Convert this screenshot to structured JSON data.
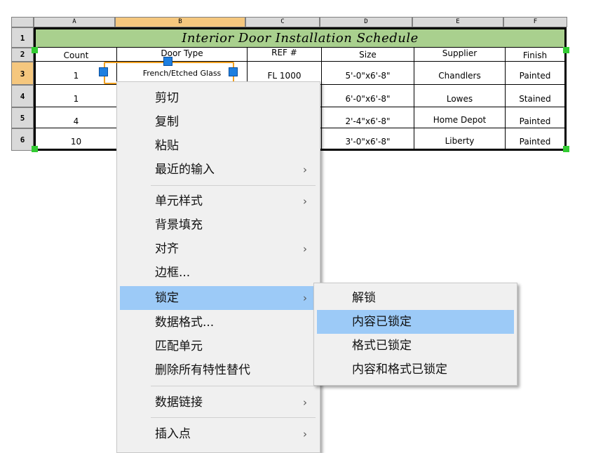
{
  "sheet": {
    "col_headers": [
      "A",
      "B",
      "C",
      "D",
      "E",
      "F"
    ],
    "row_headers": [
      "1",
      "2",
      "3",
      "4",
      "5",
      "6"
    ],
    "title": "Interior Door Installation Schedule",
    "columns": [
      "Count",
      "Door Type",
      "REF #",
      "Size",
      "Supplier",
      "Finish"
    ],
    "rows": [
      [
        "1",
        "French/Etched Glass",
        "FL 1000",
        "5'-0\"x6'-8\"",
        "Chandlers",
        "Painted"
      ],
      [
        "1",
        "",
        "",
        "6'-0\"x6'-8\"",
        "Lowes",
        "Stained"
      ],
      [
        "4",
        "",
        "",
        "2'-4\"x6'-8\"",
        "Home Depot",
        "Painted"
      ],
      [
        "10",
        "",
        "",
        "3'-0\"x6'-8\"",
        "Liberty",
        "Painted"
      ]
    ]
  },
  "context_menu": {
    "items": [
      {
        "label": "剪切",
        "submenu": false
      },
      {
        "label": "复制",
        "submenu": false
      },
      {
        "label": "粘贴",
        "submenu": false
      },
      {
        "label": "最近的输入",
        "submenu": true
      },
      {
        "label": "单元样式",
        "submenu": true
      },
      {
        "label": "背景填充",
        "submenu": false
      },
      {
        "label": "对齐",
        "submenu": true
      },
      {
        "label": "边框...",
        "submenu": false
      },
      {
        "label": "锁定",
        "submenu": true
      },
      {
        "label": "数据格式...",
        "submenu": false
      },
      {
        "label": "匹配单元",
        "submenu": false
      },
      {
        "label": "删除所有特性替代",
        "submenu": false
      },
      {
        "label": "数据链接",
        "submenu": true
      },
      {
        "label": "插入点",
        "submenu": true
      }
    ],
    "arrow_glyph": "›"
  },
  "lock_submenu": {
    "items": [
      "解锁",
      "内容已锁定",
      "格式已锁定",
      "内容和格式已锁定"
    ]
  },
  "colors": {
    "title_fill": "#a9d08e",
    "header_selected": "#f5c77e",
    "menu_highlight": "#9ccaf7",
    "grip_green": "#33cc33",
    "grip_blue": "#1e7fe0"
  },
  "icons": [
    "column-header-icon",
    "grip-handle-icon",
    "submenu-arrow-icon"
  ]
}
